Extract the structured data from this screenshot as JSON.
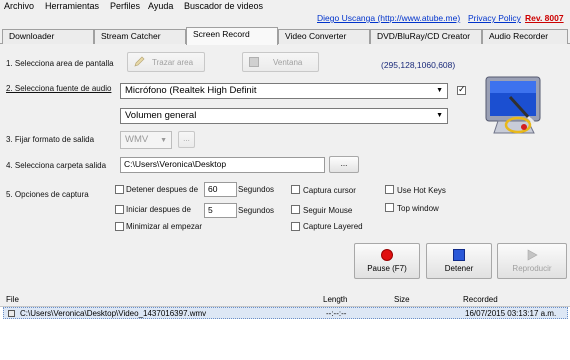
{
  "menu": [
    "Archivo",
    "Herramientas",
    "Perfiles",
    "Ayuda",
    "Buscador de videos"
  ],
  "credit": {
    "author": "Diego Uscanga (http://www.atube.me)",
    "privacy": "Privacy Policy",
    "rev": "Rev. 8007"
  },
  "tabs": [
    "Downloader",
    "Stream Catcher",
    "Screen Record",
    "Video Converter",
    "DVD/BluRay/CD Creator",
    "Audio Recorder"
  ],
  "active_tab": "Screen Record",
  "area": {
    "label": "1. Selecciona area de pantalla",
    "trazar": "Trazar area",
    "ventana": "Ventana",
    "coords": "(295,128,1060,608)"
  },
  "audio": {
    "label": "2. Selecciona fuente de audio",
    "device": "Micrófono (Realtek High Definit",
    "volume": "Volumen general",
    "enabled": true
  },
  "format": {
    "label": "3. Fijar formato de salida",
    "value": "WMV",
    "more": "..."
  },
  "folder": {
    "label": "4. Selecciona carpeta salida",
    "path": "C:\\Users\\Veronica\\Desktop",
    "browse": "..."
  },
  "capture": {
    "label": "5. Opciones de captura",
    "stop_after_label": "Detener despues de",
    "stop_after_value": "60",
    "stop_units": "Segundos",
    "start_after_label": "Iniciar despues de",
    "start_after_value": "5",
    "start_units": "Segundos",
    "minimize": "Minimizar al empezar",
    "capture_cursor": "Captura cursor",
    "follow_mouse": "Seguir Mouse",
    "capture_layered": "Capture Layered",
    "hot_keys": "Use Hot Keys",
    "top_window": "Top window"
  },
  "actions": {
    "pause": "Pause (F7)",
    "stop": "Detener",
    "play": "Reproducir"
  },
  "table": {
    "headers": [
      "File",
      "Length",
      "Size",
      "Recorded"
    ],
    "rows": [
      {
        "file": "C:\\Users\\Veronica\\Desktop\\Video_1437016397.wmv",
        "length": "--:--:--",
        "size": "",
        "recorded": "16/07/2015 03:13:17 a.m."
      }
    ]
  }
}
